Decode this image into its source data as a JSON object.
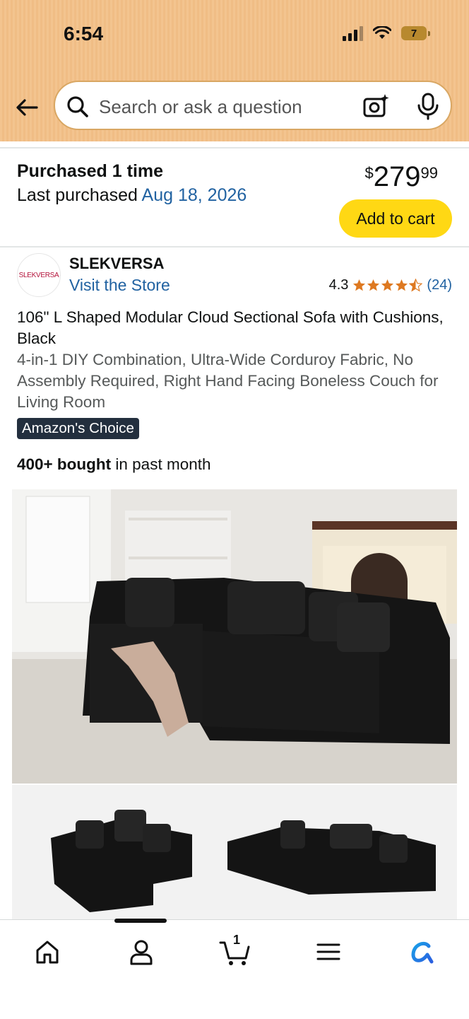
{
  "status_bar": {
    "time": "6:54",
    "battery": "7"
  },
  "search": {
    "placeholder": "Search or ask a question"
  },
  "purchase": {
    "title": "Purchased 1 time",
    "last_label": "Last purchased",
    "last_date": "Aug 18, 2026"
  },
  "price": {
    "currency": "$",
    "whole": "279",
    "fraction": "99"
  },
  "add_to_cart": "Add to cart",
  "store": {
    "logo_text": "SLEKVERSA",
    "name": "SLEKVERSA",
    "visit": "Visit the Store",
    "rating": "4.3",
    "rating_count": "(24)"
  },
  "product": {
    "title": "106\" L Shaped Modular Cloud Sectional Sofa with Cushions, Black",
    "subtitle": "4-in-1 DIY Combination, Ultra-Wide Corduroy Fabric, No Assembly Required, Right Hand Facing Boneless Couch for Living Room",
    "badge": "Amazon's Choice",
    "bought_bold": "400+ bought",
    "bought_rest": " in past month"
  },
  "bottom_nav": {
    "cart_count": "1"
  },
  "colors": {
    "header": "#f3c48f",
    "accent_link": "#2162a1",
    "cart_button": "#ffd814",
    "star": "#de7921"
  }
}
